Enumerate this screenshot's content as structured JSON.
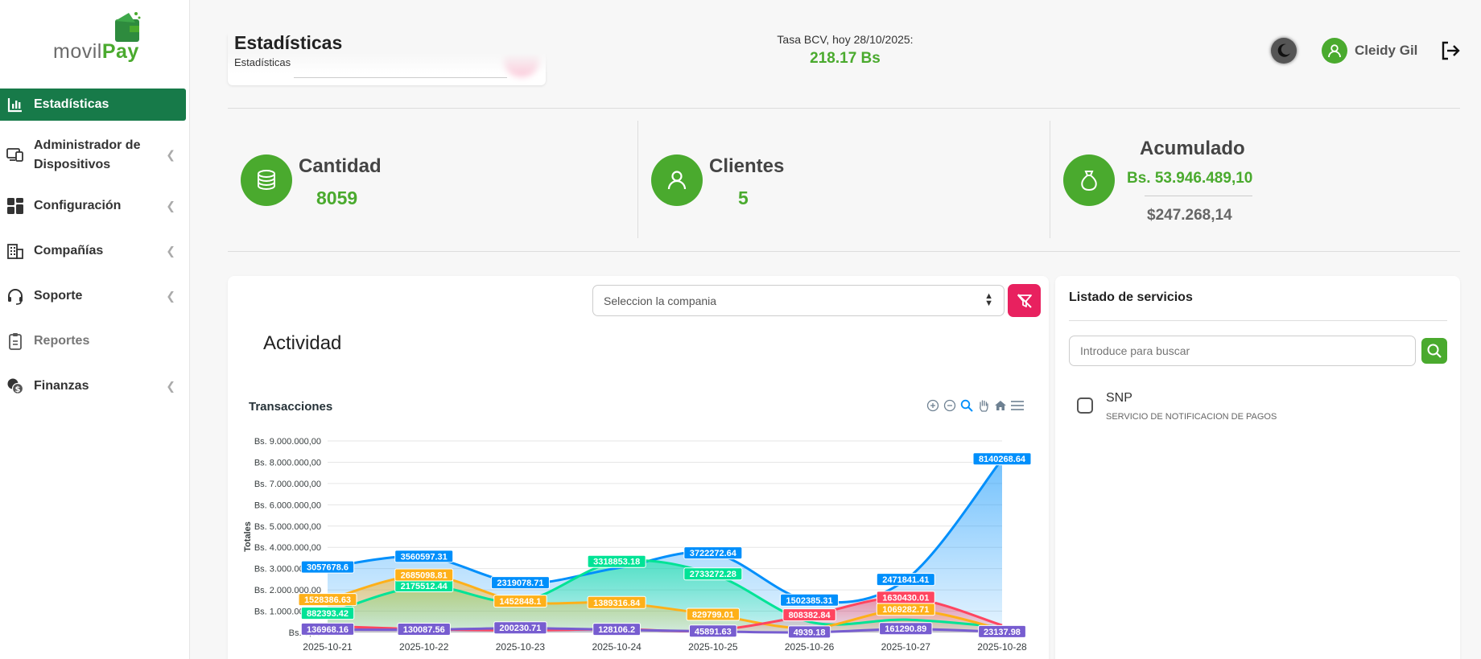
{
  "brand": {
    "logo_part1": "movil",
    "logo_part2": "Pay"
  },
  "sidebar": {
    "items": [
      {
        "label": "Estadísticas",
        "icon": "bar-chart-icon",
        "active": true
      },
      {
        "label": "Administrador de Dispositivos",
        "icon": "devices-icon",
        "has_submenu": true
      },
      {
        "label": "Configuración",
        "icon": "dashboard-grid-icon",
        "has_submenu": true
      },
      {
        "label": "Compañías",
        "icon": "building-icon",
        "has_submenu": true
      },
      {
        "label": "Soporte",
        "icon": "headset-icon",
        "has_submenu": true
      },
      {
        "label": "Reportes",
        "icon": "clipboard-icon",
        "muted": true
      },
      {
        "label": "Finanzas",
        "icon": "coins-icon",
        "has_submenu": true
      }
    ]
  },
  "header": {
    "title": "Estadísticas",
    "breadcrumb": "Estadísticas",
    "bcv_label": "Tasa BCV, hoy 28/10/2025:",
    "bcv_value": "218.17 Bs",
    "user_name": "Cleidy Gil"
  },
  "stats": {
    "cantidad": {
      "label": "Cantidad",
      "value": "8059"
    },
    "clientes": {
      "label": "Clientes",
      "value": "5"
    },
    "acumulado": {
      "label": "Acumulado",
      "value_bs": "Bs. 53.946.489,10",
      "value_usd": "$247.268,14"
    }
  },
  "activity": {
    "company_select_placeholder": "Seleccion la compania",
    "title": "Actividad"
  },
  "services": {
    "title": "Listado de servicios",
    "search_placeholder": "Introduce para buscar",
    "items": [
      {
        "name": "SNP",
        "description": "SERVICIO DE NOTIFICACION DE PAGOS"
      }
    ]
  },
  "colors": {
    "primary_green": "#4aaa2e",
    "active_green": "#177a49",
    "pink_button": "#e8215f"
  },
  "chart_data": {
    "type": "area",
    "title": "Transacciones",
    "ylabel": "Totales",
    "xlabel": "",
    "ylim": [
      0,
      9000000
    ],
    "y_ticks": [
      "Bs. 9.000.000,00",
      "Bs. 8.000.000,00",
      "Bs. 7.000.000,00",
      "Bs. 6.000.000,00",
      "Bs. 5.000.000,00",
      "Bs. 4.000.000,00",
      "Bs. 3.000.000,00",
      "Bs. 2.000.000,00",
      "Bs. 1.000.000,00",
      "Bs. 0,00"
    ],
    "x": [
      "2025-10-21",
      "2025-10-22",
      "2025-10-23",
      "2025-10-24",
      "2025-10-25",
      "2025-10-26",
      "2025-10-27",
      "2025-10-28"
    ],
    "grid": true,
    "series": [
      {
        "color": "#008ffb",
        "values": [
          3057678.6,
          3560597.31,
          2319078.71,
          null,
          3722272.64,
          1502385.31,
          2471841.41,
          8140268.64
        ],
        "labels": [
          "3057678.6",
          "3560597.31",
          "2319078.71",
          "",
          "3722272.64",
          "1502385.31",
          "2471841.41",
          "8140268.64"
        ]
      },
      {
        "color": "#00e396",
        "values": [
          882393.42,
          2175512.44,
          1452848.1,
          3318853.18,
          2733272.28,
          500000,
          600000,
          250000
        ],
        "labels": [
          "882393.42",
          "2175512.44",
          "",
          "3318853.18",
          "2733272.28",
          "",
          "",
          ""
        ]
      },
      {
        "color": "#feb019",
        "values": [
          1528386.63,
          2685098.81,
          1452848.1,
          1389316.84,
          829799.01,
          200000,
          1069282.71,
          150000
        ],
        "labels": [
          "1528386.63",
          "2685098.81",
          "1452848.1",
          "1389316.84",
          "829799.01",
          "",
          "1069282.71",
          ""
        ]
      },
      {
        "color": "#ff4560",
        "values": [
          300000,
          150000,
          100000,
          150000,
          100000,
          808382.84,
          1630430.01,
          336563.57
        ],
        "labels": [
          "",
          "",
          "",
          "",
          "",
          "808382.84",
          "1630430.01",
          ""
        ]
      },
      {
        "color": "#775dd0",
        "values": [
          136968.16,
          130087.56,
          200230.71,
          128106.2,
          45891.63,
          4939.18,
          161290.89,
          23137.98
        ],
        "labels": [
          "136968.16",
          "130087.56",
          "200230.71",
          "128106.2",
          "45891.63",
          "4939.18",
          "161290.89",
          "23137.98"
        ]
      }
    ]
  }
}
